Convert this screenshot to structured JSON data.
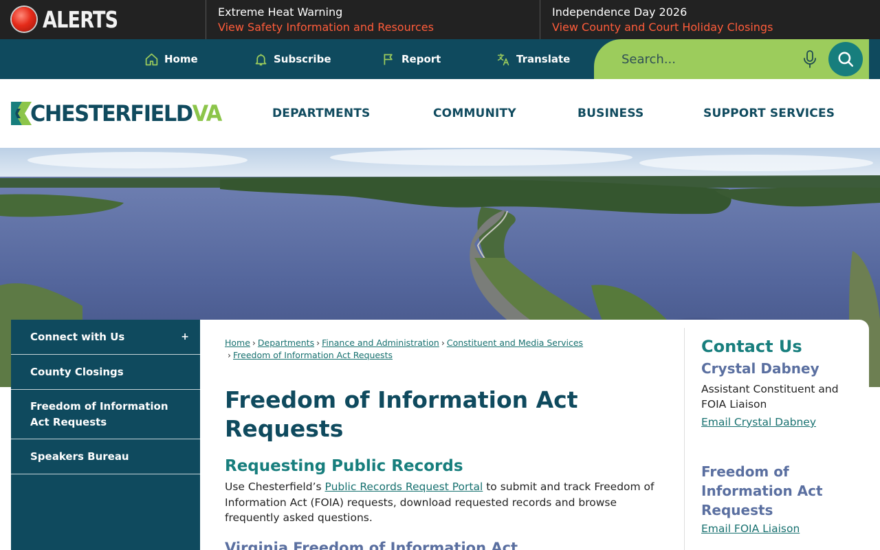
{
  "alerts": {
    "brand_label": "ALERTS",
    "items": [
      {
        "title": "Extreme Heat Warning",
        "link": "View Safety Information and Resources"
      },
      {
        "title": "Independence Day 2026",
        "link": "View County and Court Holiday Closings"
      }
    ]
  },
  "utility_nav": {
    "links": [
      {
        "label": "Home",
        "icon": "home-icon"
      },
      {
        "label": "Subscribe",
        "icon": "bell-icon"
      },
      {
        "label": "Report",
        "icon": "flag-icon"
      },
      {
        "label": "Translate",
        "icon": "translate-icon"
      }
    ],
    "search": {
      "placeholder": "Search...",
      "value": ""
    }
  },
  "header": {
    "logo_main": "CHESTERFIELD",
    "logo_suffix": "VA",
    "nav": [
      "DEPARTMENTS",
      "COMMUNITY",
      "BUSINESS",
      "SUPPORT SERVICES"
    ]
  },
  "sidebar": {
    "items": [
      {
        "label": "Connect with Us",
        "expand": "+"
      },
      {
        "label": "County Closings"
      },
      {
        "label": "Freedom of Information Act Requests"
      },
      {
        "label": "Speakers Bureau"
      }
    ]
  },
  "breadcrumb": {
    "items": [
      "Home",
      "Departments",
      "Finance and Administration",
      "Constituent and Media Services",
      "Freedom of Information Act Requests"
    ],
    "separator": "›"
  },
  "main": {
    "title": "Freedom of Information Act Requests",
    "section1_title": "Requesting Public Records",
    "section1_pre": "Use Chesterfield’s ",
    "section1_link": "Public Records Request Portal",
    "section1_post": " to submit and track Freedom of Information Act (FOIA) requests, download requested records and browse frequently asked questions.",
    "section2_title": "Virginia Freedom of Information Act"
  },
  "contact": {
    "heading": "Contact Us",
    "name": "Crystal Dabney",
    "role": "Assistant Constituent and FOIA Liaison",
    "email_label": "Email Crystal Dabney",
    "heading2": "Freedom of Information Act Requests",
    "email2_label": "Email FOIA Liaison"
  },
  "colors": {
    "brand_dark": "#0f4a5e",
    "brand_green": "#8cc54a",
    "teal": "#177e7d",
    "alert_red": "#ff5c3a"
  }
}
